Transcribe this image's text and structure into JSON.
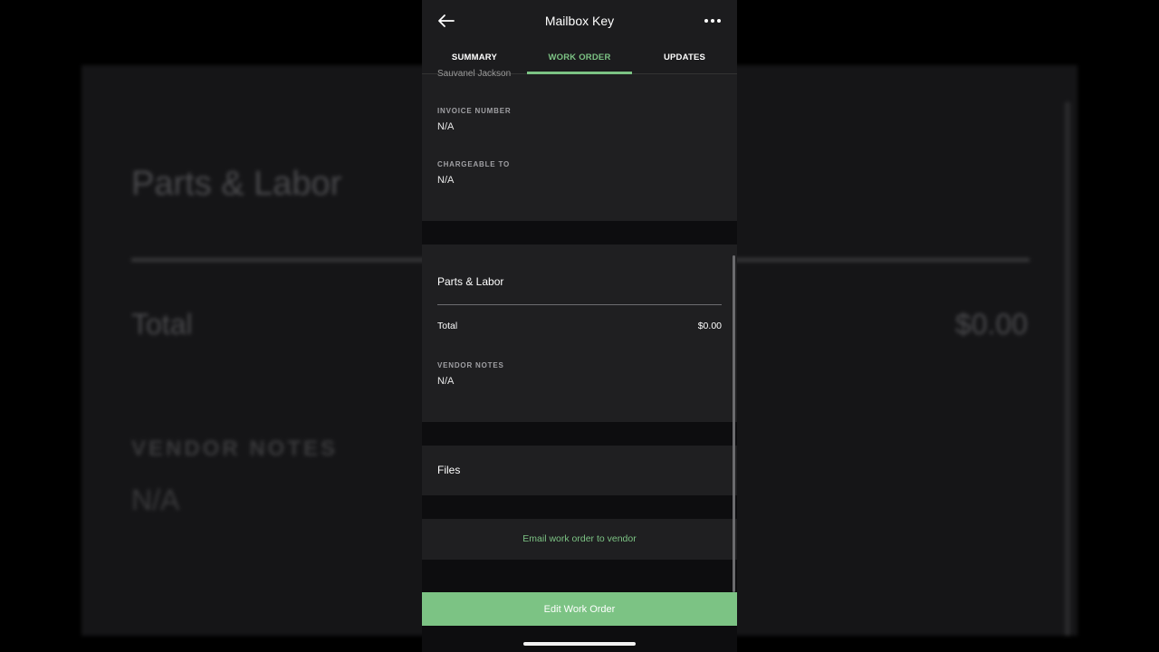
{
  "background": {
    "title": "Parts & Labor",
    "total_label": "Total",
    "total_amount": "$0.00",
    "notes_label": "VENDOR NOTES",
    "notes_value": "N/A"
  },
  "header": {
    "title": "Mailbox Key",
    "back_icon": "arrow-left-icon",
    "more_icon": "more-horizontal-icon"
  },
  "tabs": [
    {
      "label": "SUMMARY",
      "active": false
    },
    {
      "label": "WORK ORDER",
      "active": true
    },
    {
      "label": "UPDATES",
      "active": false
    }
  ],
  "details": {
    "cut_off_text": "Sauvanel Jackson",
    "fields": [
      {
        "label": "INVOICE NUMBER",
        "value": "N/A"
      },
      {
        "label": "CHARGEABLE TO",
        "value": "N/A"
      }
    ]
  },
  "parts_labor": {
    "title": "Parts & Labor",
    "total_label": "Total",
    "total_amount": "$0.00",
    "notes_label": "VENDOR NOTES",
    "notes_value": "N/A"
  },
  "files": {
    "title": "Files"
  },
  "email": {
    "label": "Email work order to vendor"
  },
  "edit_button": {
    "label": "Edit Work Order"
  },
  "colors": {
    "accent": "#7cc384",
    "card": "#1f1f21",
    "background": "#0d0d0f"
  }
}
